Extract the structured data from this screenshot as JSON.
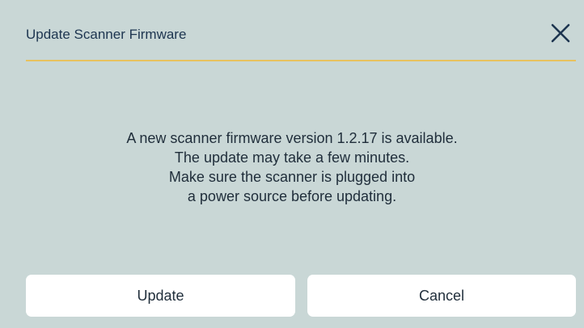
{
  "dialog": {
    "title": "Update Scanner Firmware",
    "close_icon": "close-icon"
  },
  "message": {
    "lines": [
      "A new scanner firmware version 1.2.17 is available.",
      "The update may take a few minutes.",
      "Make sure the scanner is plugged into",
      "a power source before updating."
    ]
  },
  "buttons": {
    "update_label": "Update",
    "cancel_label": "Cancel"
  },
  "colors": {
    "background": "#c9d7d6",
    "accent_divider": "#e8c25f",
    "title_text": "#1d3550",
    "button_background": "#ffffff"
  }
}
